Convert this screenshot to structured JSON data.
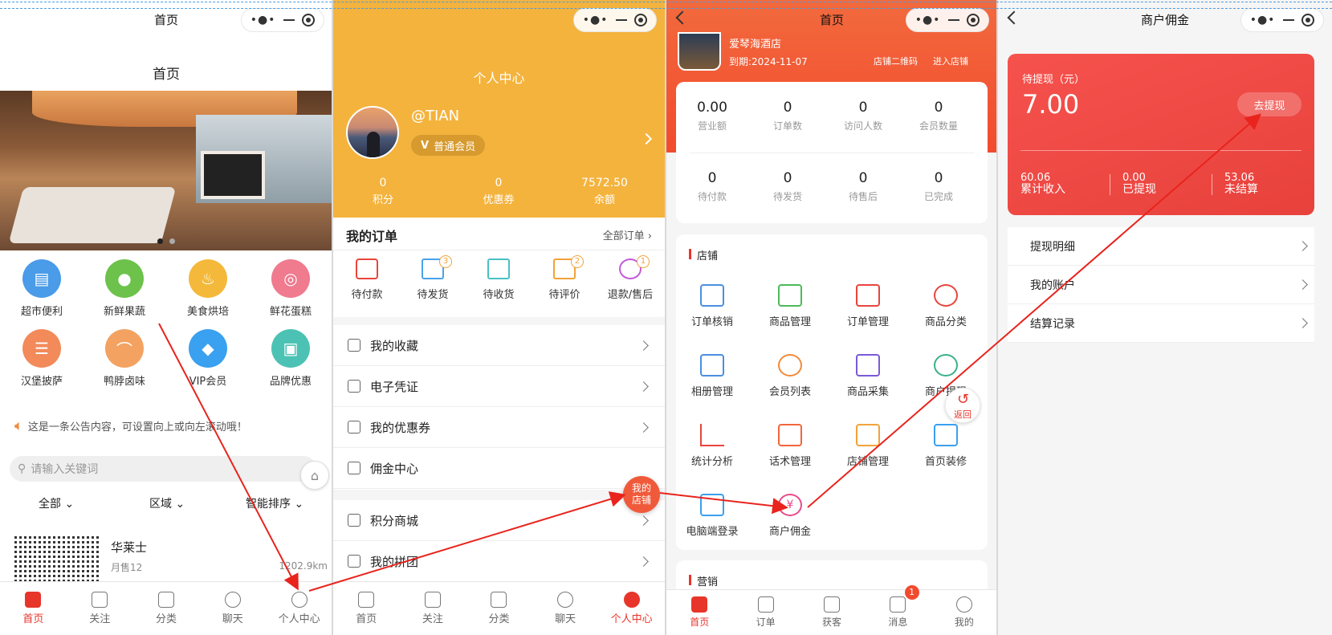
{
  "panel1": {
    "nav_title": "首页",
    "header_title": "首页",
    "categories": [
      {
        "label": "超市便利",
        "color": "#4a9be8"
      },
      {
        "label": "新鲜果蔬",
        "color": "#6cc24a"
      },
      {
        "label": "美食烘培",
        "color": "#f4b93a"
      },
      {
        "label": "鲜花蛋糕",
        "color": "#f07a8e"
      },
      {
        "label": "汉堡披萨",
        "color": "#f28a5a"
      },
      {
        "label": "鸭脖卤味",
        "color": "#f4a261"
      },
      {
        "label": "VIP会员",
        "color": "#3aa0f0"
      },
      {
        "label": "品牌优惠",
        "color": "#4cc2b4"
      }
    ],
    "notice": "这是一条公告内容，可设置向上或向左滚动哦！",
    "search_placeholder": "请输入关键词",
    "filters": [
      "全部",
      "区域",
      "智能排序"
    ],
    "store": {
      "name": "华莱士",
      "sales": "月售12",
      "distance": "1202.9km"
    },
    "tabs": [
      "首页",
      "关注",
      "分类",
      "聊天",
      "个人中心"
    ]
  },
  "panel2": {
    "title": "个人中心",
    "username": "@TIAN",
    "member_level": "普通会员",
    "stats": [
      {
        "value": "0",
        "label": "积分"
      },
      {
        "value": "0",
        "label": "优惠券"
      },
      {
        "value": "7572.50",
        "label": "余额"
      }
    ],
    "orders_title": "我的订单",
    "orders_all": "全部订单",
    "order_items": [
      {
        "label": "待付款",
        "badge": ""
      },
      {
        "label": "待发货",
        "badge": "3"
      },
      {
        "label": "待收货",
        "badge": ""
      },
      {
        "label": "待评价",
        "badge": "2"
      },
      {
        "label": "退款/售后",
        "badge": "1"
      }
    ],
    "menu": [
      "我的收藏",
      "电子凭证",
      "我的优惠券",
      "佣金中心"
    ],
    "menu2": [
      "积分商城",
      "我的拼团"
    ],
    "shop_float": "我的店铺",
    "tabs": [
      "首页",
      "关注",
      "分类",
      "聊天",
      "个人中心"
    ]
  },
  "panel3": {
    "nav_title": "首页",
    "shop_name": "爱琴海酒店",
    "expiry": "到期:2024-11-07",
    "qr_label": "店铺二维码",
    "enter_label": "进入店铺",
    "stats_row1": [
      {
        "value": "0.00",
        "label": "营业额"
      },
      {
        "value": "0",
        "label": "订单数"
      },
      {
        "value": "0",
        "label": "访问人数"
      },
      {
        "value": "0",
        "label": "会员数量"
      }
    ],
    "stats_row2": [
      {
        "value": "0",
        "label": "待付款"
      },
      {
        "value": "0",
        "label": "待发货"
      },
      {
        "value": "0",
        "label": "待售后"
      },
      {
        "value": "0",
        "label": "已完成"
      }
    ],
    "section_shop": "店铺",
    "grid": [
      "订单核销",
      "商品管理",
      "订单管理",
      "商品分类",
      "相册管理",
      "会员列表",
      "商品采集",
      "商户提现",
      "统计分析",
      "话术管理",
      "店铺管理",
      "首页装修",
      "电脑端登录",
      "商户佣金"
    ],
    "section_marketing": "营销",
    "back_float": "返回",
    "tabs": [
      "首页",
      "订单",
      "获客",
      "消息",
      "我的"
    ],
    "msg_badge": "1"
  },
  "panel4": {
    "nav_title": "商户佣金",
    "pending_label": "待提现（元）",
    "pending_value": "7.00",
    "withdraw_button": "去提现",
    "summary": [
      {
        "value": "60.06",
        "label": "累计收入"
      },
      {
        "value": "0.00",
        "label": "已提现"
      },
      {
        "value": "53.06",
        "label": "未结算"
      }
    ],
    "list": [
      "提现明细",
      "我的账户",
      "结算记录"
    ]
  }
}
